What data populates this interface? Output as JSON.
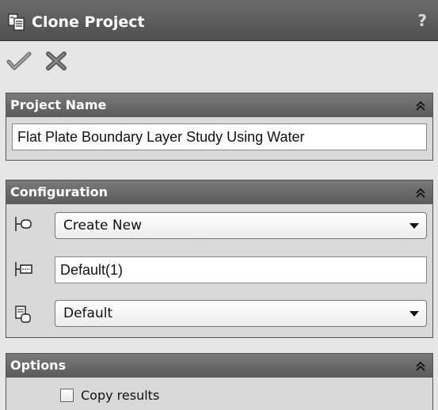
{
  "window": {
    "title": "Clone Project",
    "help_label": "?",
    "icons": {
      "title": "clone-project-icon",
      "help": "help-icon"
    }
  },
  "actions": {
    "ok_icon": "checkmark-icon",
    "cancel_icon": "x-cross-icon"
  },
  "project_name": {
    "header": "Project Name",
    "value": "Flat Plate Boundary Layer Study Using Water"
  },
  "configuration": {
    "header": "Configuration",
    "mode": {
      "selected": "Create New",
      "icon": "configuration-mode-icon"
    },
    "name": {
      "value": "Default(1)",
      "icon": "configuration-name-icon"
    },
    "base": {
      "selected": "Default",
      "icon": "base-configuration-icon"
    }
  },
  "options": {
    "header": "Options",
    "copy_results": {
      "label": "Copy results",
      "checked": false
    }
  },
  "colors": {
    "header_bg": "#5f5f5f",
    "panel_bg": "#e6e6e6",
    "group_bg": "#d9d9d9"
  }
}
